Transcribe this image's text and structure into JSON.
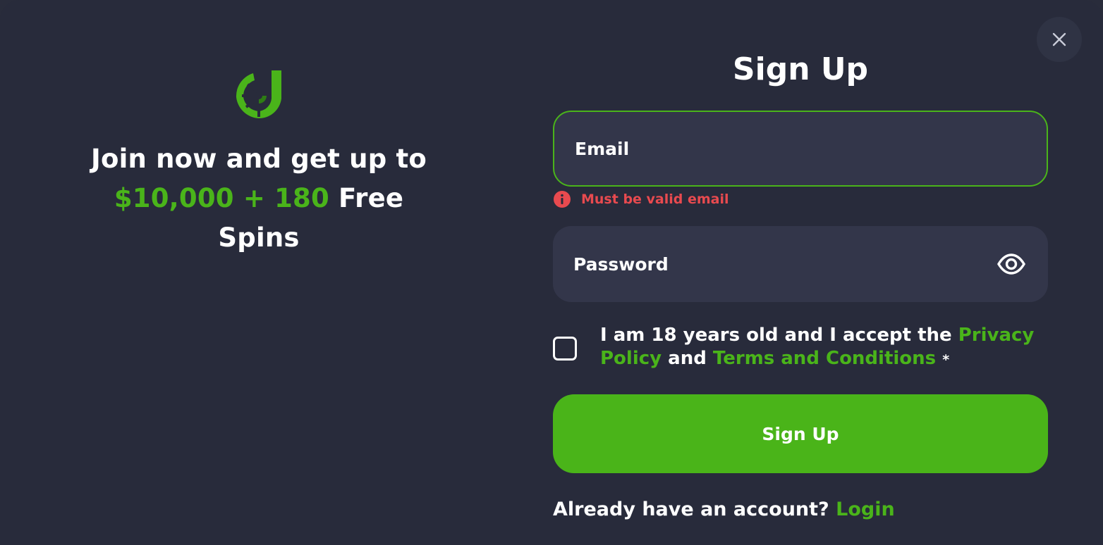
{
  "modal": {
    "close_icon": "close-icon"
  },
  "promo": {
    "logo_icon": "brand-logo-icon",
    "line1": "Join now and get up to",
    "highlight": "$10,000 + 180",
    "line2_rest": "Free",
    "line3": "Spins"
  },
  "form": {
    "title": "Sign Up",
    "email": {
      "placeholder": "Email",
      "value": "",
      "error": "Must be valid email"
    },
    "password": {
      "placeholder": "Password",
      "value": "",
      "toggle_icon": "eye-icon"
    },
    "consent": {
      "prefix": "I am 18 years old and I accept the",
      "privacy_link": "Privacy Policy",
      "and": "and",
      "terms_link": "Terms and Conditions",
      "required_mark": "*"
    },
    "submit_label": "Sign Up",
    "login_prompt": "Already have an account?",
    "login_link": "Login"
  },
  "colors": {
    "background": "#282b3b",
    "field": "#33364a",
    "accent": "#4ab41a",
    "error": "#e84a4f"
  }
}
